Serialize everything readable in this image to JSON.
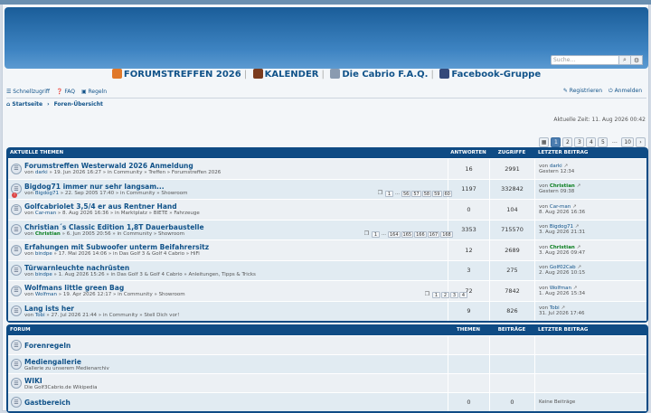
{
  "search": {
    "placeholder": "Suche…",
    "search_icon": "search-icon",
    "advanced_icon": "gear-icon"
  },
  "header_links": [
    {
      "label": "FORUMSTREFFEN 2026",
      "color": "#e0792a"
    },
    {
      "label": "KALENDER",
      "color": "#7a3b1e"
    },
    {
      "label": "Die Cabrio F.A.Q.",
      "color": "#8a9bb0"
    },
    {
      "label": "Facebook-Gruppe",
      "color": "#34497a"
    }
  ],
  "nav": {
    "quick": "Schnellzugriff",
    "faq": "FAQ",
    "rules": "Regeln",
    "register": "Registrieren",
    "login": "Anmelden",
    "home": "Startseite",
    "overview": "Foren-Übersicht"
  },
  "current_time": "Aktuelle Zeit: 11. Aug 2026 00:42",
  "pagination": {
    "pages": [
      "1",
      "2",
      "3",
      "4",
      "5"
    ],
    "dots": "…",
    "last": "10"
  },
  "topics_panel": {
    "title": "AKTUELLE THEMEN",
    "col_replies": "ANTWORTEN",
    "col_views": "ZUGRIFFE",
    "col_last": "LETZTER BEITRAG"
  },
  "topics": [
    {
      "title": "Forumstreffen Westerwald 2026 Anmeldung",
      "by": "von",
      "author": "darki",
      "meta": " » 19. Jun 2026 16:27 » in Community » Treffen » Forumstreffen 2026",
      "replies": "16",
      "views": "2991",
      "last_by": "darki",
      "last_date": "Gestern 12:34"
    },
    {
      "title": "Bigdog71 immer nur sehr langsam...",
      "by": "von",
      "author": "Bigdog71",
      "meta": " » 22. Sep 2005 17:40 » in Community » Showroom",
      "replies": "1197",
      "views": "332842",
      "last_by": "Christian",
      "last_date": "Gestern 09:38",
      "pages": [
        "1",
        "56",
        "57",
        "58",
        "59",
        "60"
      ]
    },
    {
      "title": "Golfcabriolet 3,5/4 er aus Rentner Hand",
      "by": "von",
      "author": "Car-man",
      "meta": " » 8. Aug 2026 16:36 » in Marktplatz » BIETE » Fahrzeuge",
      "replies": "0",
      "views": "104",
      "last_by": "Car-man",
      "last_date": "8. Aug 2026 16:36"
    },
    {
      "title": "Christian´s Classic Edition 1,8T Dauerbaustelle",
      "by": "von",
      "author": "Christian",
      "meta": " » 6. Jun 2005 20:56 » in Community » Showroom",
      "replies": "3353",
      "views": "715570",
      "last_by": "Bigdog71",
      "last_date": "3. Aug 2026 21:31",
      "pages": [
        "1",
        "164",
        "165",
        "166",
        "167",
        "168"
      ]
    },
    {
      "title": "Erfahungen mit Subwoofer unterm Beifahrersitz",
      "by": "von",
      "author": "bindpe",
      "meta": " » 17. Mai 2026 14:06 » in Das Golf 3 & Golf 4 Cabrio » HiFi",
      "replies": "12",
      "views": "2689",
      "last_by": "Christian",
      "last_date": "3. Aug 2026 09:47"
    },
    {
      "title": "Türwarnleuchte nachrüsten",
      "by": "von",
      "author": "bindpe",
      "meta": " » 1. Aug 2026 15:26 » in Das Golf 3 & Golf 4 Cabrio » Anleitungen, Tipps & Tricks",
      "replies": "3",
      "views": "275",
      "last_by": "Golf02Cab",
      "last_date": "2. Aug 2026 10:15"
    },
    {
      "title": "Wolfmans little green Bag",
      "by": "von",
      "author": "Wolfman",
      "meta": " » 19. Apr 2026 12:17 » in Community » Showroom",
      "replies": "72",
      "views": "7842",
      "last_by": "Wolfman",
      "last_date": "1. Aug 2026 15:34",
      "pages": [
        "1",
        "2",
        "3",
        "4"
      ]
    },
    {
      "title": "Lang ists her",
      "by": "von",
      "author": "Tobi",
      "meta": " » 27. Jul 2026 21:44 » in Community » Stell Dich vor!",
      "replies": "9",
      "views": "826",
      "last_by": "Tobi",
      "last_date": "31. Jul 2026 17:46"
    }
  ],
  "forum_panel": {
    "title": "FORUM",
    "col_topics": "THEMEN",
    "col_posts": "BEITRÄGE",
    "col_last": "LETZTER BEITRAG"
  },
  "forums": [
    {
      "title": "Forenregeln",
      "desc": "",
      "topics": "",
      "posts": "",
      "last": ""
    },
    {
      "title": "Mediengallerie",
      "desc": "Gallerie zu unserem Medienarchiv",
      "topics": "",
      "posts": "",
      "last": ""
    },
    {
      "title": "WIKI",
      "desc": "Die Golf3Cabrio.de Wikipedia",
      "topics": "",
      "posts": "",
      "last": ""
    },
    {
      "title": "Gastbereich",
      "desc": "",
      "topics": "0",
      "posts": "0",
      "last": "Keine Beiträge"
    }
  ],
  "last_prefix": "von"
}
